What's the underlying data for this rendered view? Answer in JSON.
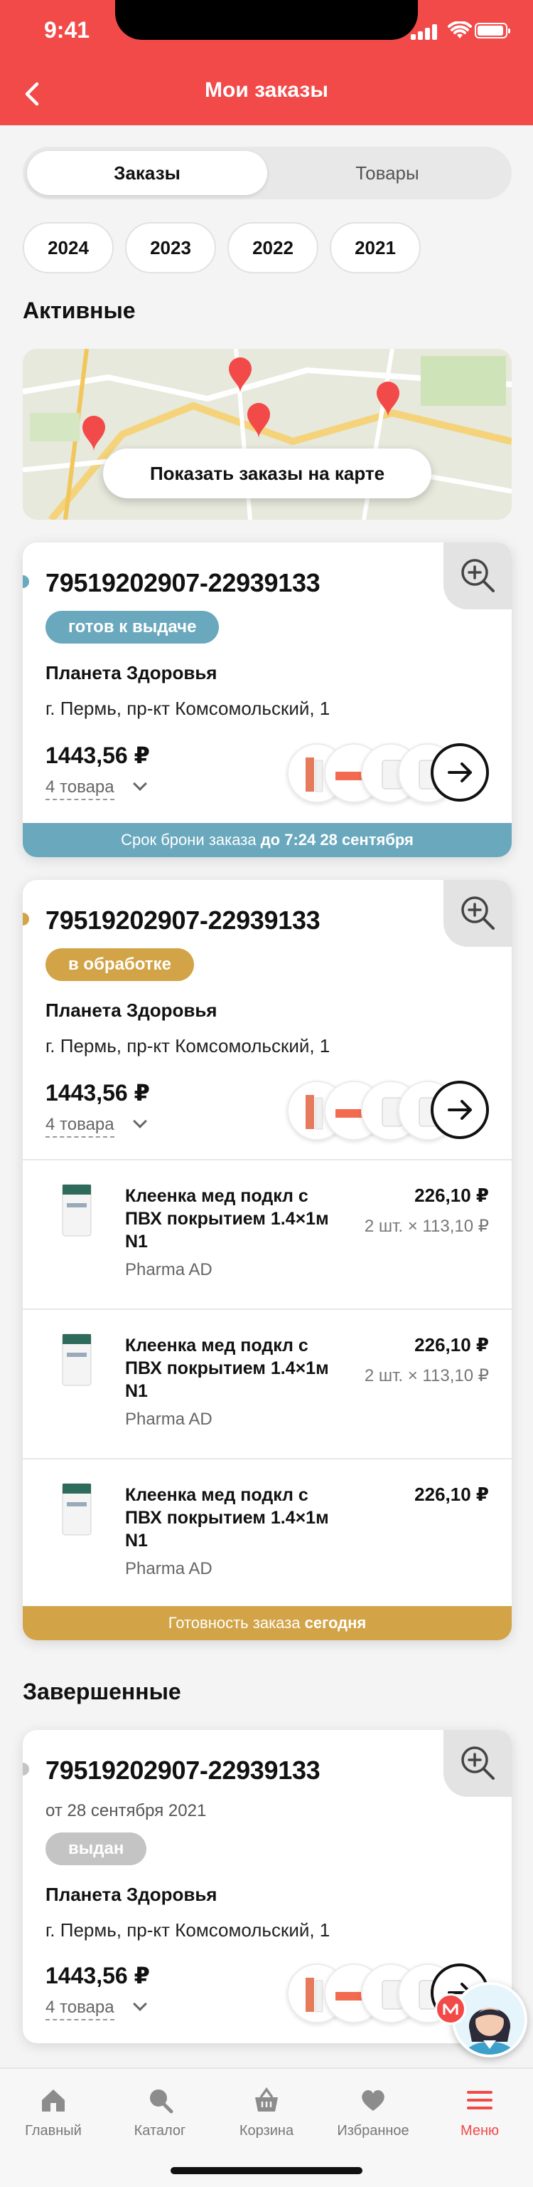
{
  "status": {
    "time": "9:41"
  },
  "header": {
    "title": "Мои заказы"
  },
  "segment": {
    "tabs": [
      "Заказы",
      "Товары"
    ],
    "active": 0
  },
  "years": [
    "2024",
    "2023",
    "2022",
    "2021"
  ],
  "sections": {
    "active_title": "Активные",
    "completed_title": "Завершенные"
  },
  "map": {
    "button_label": "Показать заказы на карте"
  },
  "orders": [
    {
      "number": "79519202907-22939133",
      "status": "готов к выдаче",
      "status_color": "#6aa8be",
      "pharmacy": "Планета Здоровья",
      "address": "г. Пермь, пр-кт Комсомольский, 1",
      "price": "1443,56 ₽",
      "items_count": "4 товара",
      "footer_text": "Срок брони заказа",
      "footer_bold": "до 7:24 28 сентября",
      "footer_color": "#6aa8be"
    },
    {
      "number": "79519202907-22939133",
      "status": "в обработке",
      "status_color": "#d2a447",
      "pharmacy": "Планета Здоровья",
      "address": "г. Пермь, пр-кт Комсомольский, 1",
      "price": "1443,56 ₽",
      "items_count": "4 товара",
      "items": [
        {
          "name": "Клеенка мед подкл с ПВХ покрытием 1.4×1м N1",
          "vendor": "Pharma AD",
          "price": "226,10 ₽",
          "qty": "2 шт. × 113,10 ₽"
        },
        {
          "name": "Клеенка мед подкл с ПВХ покрытием 1.4×1м N1",
          "vendor": "Pharma AD",
          "price": "226,10 ₽",
          "qty": "2 шт. × 113,10 ₽"
        },
        {
          "name": "Клеенка мед подкл с ПВХ покрытием 1.4×1м N1",
          "vendor": "Pharma AD",
          "price": "226,10 ₽",
          "qty": ""
        }
      ],
      "footer_text": "Готовность заказа",
      "footer_bold": "сегодня",
      "footer_color": "#d2a447"
    },
    {
      "number": "79519202907-22939133",
      "date": "от 28 сентября 2021",
      "status": "выдан",
      "status_color": "#c4c4c4",
      "pharmacy": "Планета Здоровья",
      "address": "г. Пермь, пр-кт Комсомольский, 1",
      "price": "1443,56 ₽",
      "items_count": "4 товара"
    }
  ],
  "tabbar": {
    "items": [
      {
        "label": "Главный",
        "icon": "home-icon"
      },
      {
        "label": "Каталог",
        "icon": "catalog-search-icon"
      },
      {
        "label": "Корзина",
        "icon": "basket-icon"
      },
      {
        "label": "Избранное",
        "icon": "heart-icon"
      },
      {
        "label": "Меню",
        "icon": "menu-icon"
      }
    ],
    "active": 4
  },
  "colors": {
    "brand": "#f24949",
    "ready": "#6aa8be",
    "processing": "#d2a447",
    "done": "#c4c4c4"
  }
}
